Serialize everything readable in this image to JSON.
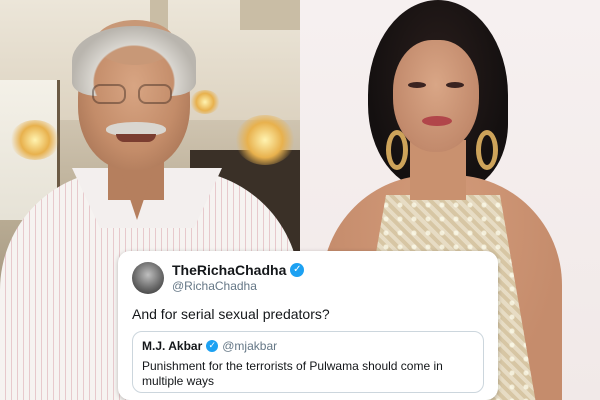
{
  "tweet": {
    "display_name": "TheRichaChadha",
    "handle": "@RichaChadha",
    "text": "And for serial sexual predators?",
    "verified_icon": "verified-badge-icon",
    "quoted": {
      "display_name": "M.J. Akbar",
      "handle": "@mjakbar",
      "text": "Punishment for the terrorists of Pulwama should come in multiple ways"
    }
  },
  "colors": {
    "verified_blue": "#1da1f2",
    "text_primary": "#14171a",
    "text_secondary": "#657786",
    "card_border": "#ccd6dd"
  }
}
